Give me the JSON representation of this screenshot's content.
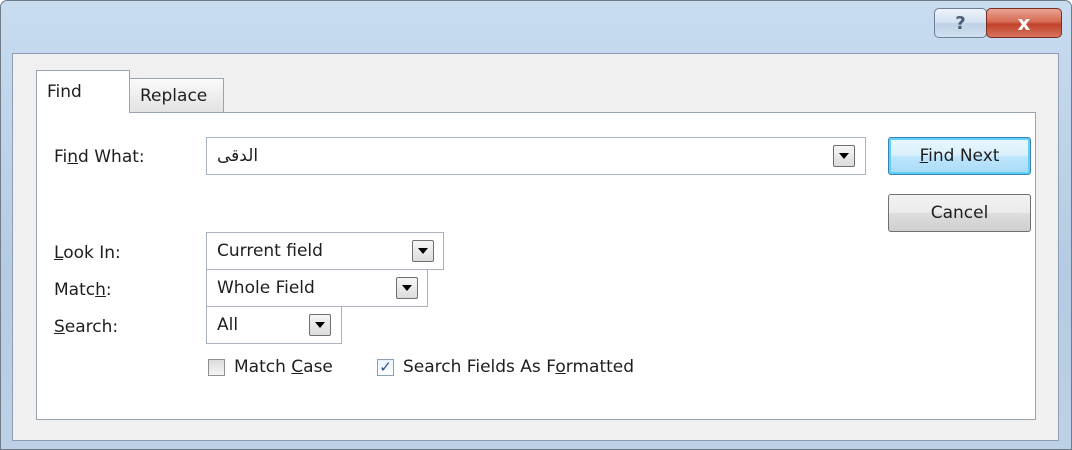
{
  "titlebar": {
    "help_glyph": "?",
    "close_glyph": "x",
    "accent": "#c1432b"
  },
  "tabs": [
    {
      "label": "Find",
      "active": true
    },
    {
      "label": "Replace",
      "active": false
    }
  ],
  "find_what": {
    "label_pre": "Fi",
    "label_key": "n",
    "label_post": "d What:",
    "value": "الدقى",
    "icon": "chevron-down-icon"
  },
  "look_in": {
    "label_key": "L",
    "label_post": "ook In:",
    "value": "Current field"
  },
  "match": {
    "label_pre": "Matc",
    "label_key": "h",
    "label_post": ":",
    "value": "Whole Field"
  },
  "search": {
    "label_key": "S",
    "label_post": "earch:",
    "value": "All"
  },
  "options": {
    "match_case": {
      "pre": "Match ",
      "key": "C",
      "post": "ase",
      "checked": false
    },
    "search_formatted": {
      "pre": "Search Fields As F",
      "key": "o",
      "post": "rmatted",
      "checked": true
    }
  },
  "buttons": {
    "find_next": {
      "key": "F",
      "post": "ind Next"
    },
    "cancel": "Cancel"
  }
}
